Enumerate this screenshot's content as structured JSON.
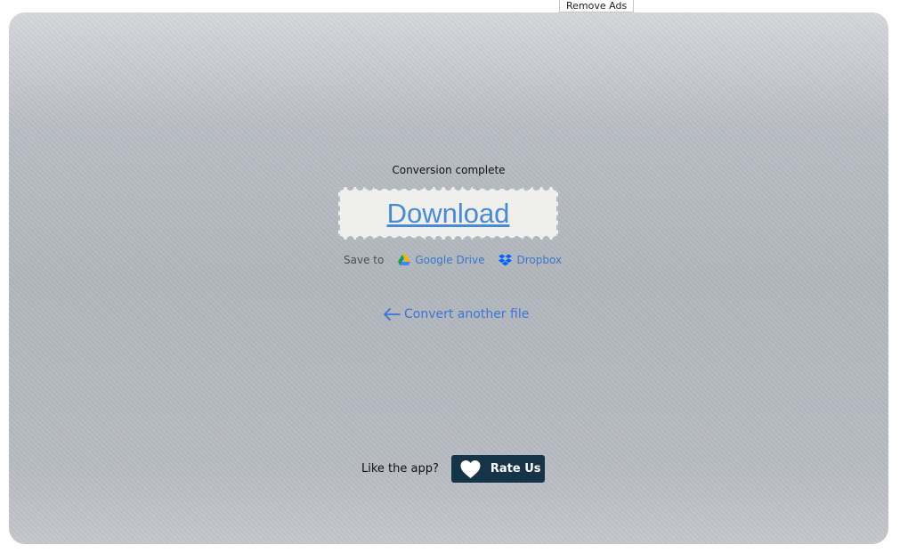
{
  "top_bar": {
    "remove_ads_label": "Remove Ads"
  },
  "result": {
    "status_text": "Conversion complete",
    "download_label": "Download",
    "save_to_label": "Save to",
    "services": [
      {
        "label": "Google Drive",
        "icon": "google-drive-icon"
      },
      {
        "label": "Dropbox",
        "icon": "dropbox-icon"
      }
    ],
    "convert_another_label": "Convert another file",
    "convert_another_icon": "arrow-left-icon"
  },
  "rating": {
    "prompt": "Like the app?",
    "button_label": "Rate Us",
    "button_icon": "heart-icon"
  },
  "colors": {
    "link": "#3d74d8",
    "download_link": "#4a8ad4",
    "rate_button_bg": "#163447",
    "panel_bg": "#b0b5bc"
  }
}
